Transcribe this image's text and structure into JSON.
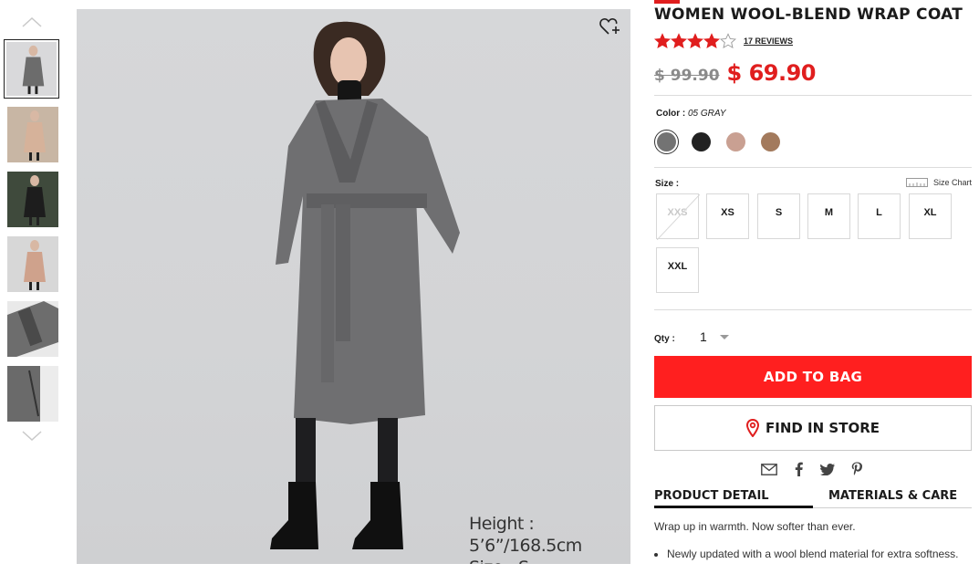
{
  "thumbnails": {
    "count": 6,
    "items": [
      {
        "name": "thumb-gray-front",
        "bg": "#d9d9db",
        "coat": "#6c6c6c"
      },
      {
        "name": "thumb-beige-indoor",
        "bg": "#c8b6a4",
        "coat": "#d6b29a"
      },
      {
        "name": "thumb-black-outdoor",
        "bg": "#3f4a3c",
        "coat": "#1d1d1d"
      },
      {
        "name": "thumb-beige-front",
        "bg": "#d7d7d7",
        "coat": "#cfa28c"
      },
      {
        "name": "thumb-belt-detail",
        "bg": "#e9e9e9",
        "coat": "#6d6d6d"
      },
      {
        "name": "thumb-hem-detail",
        "bg": "#ececec",
        "coat": "#6a6a6a"
      }
    ]
  },
  "main_image": {
    "caption_height": "Height : 5’6”/168.5cm",
    "caption_size": "Size : S"
  },
  "product": {
    "title": "WOMEN WOOL-BLEND WRAP COAT",
    "rating": 4,
    "rating_max": 5,
    "reviews_label": "17 REVIEWS",
    "old_price": "$ 99.90",
    "price": "$ 69.90"
  },
  "colors": {
    "label": "Color : ",
    "selected_name": "05 GRAY",
    "swatches": [
      {
        "hex": "#737373",
        "selected": true
      },
      {
        "hex": "#222222",
        "selected": false
      },
      {
        "hex": "#c9a092",
        "selected": false
      },
      {
        "hex": "#a37a5d",
        "selected": false
      }
    ]
  },
  "sizes": {
    "label": "Size :",
    "chart_label": "Size Chart",
    "options": [
      {
        "label": "XXS",
        "disabled": true
      },
      {
        "label": "XS",
        "disabled": false
      },
      {
        "label": "S",
        "disabled": false
      },
      {
        "label": "M",
        "disabled": false
      },
      {
        "label": "L",
        "disabled": false
      },
      {
        "label": "XL",
        "disabled": false
      },
      {
        "label": "XXL",
        "disabled": false
      }
    ]
  },
  "qty": {
    "label": "Qty :",
    "value": "1"
  },
  "actions": {
    "add_to_bag": "ADD TO BAG",
    "find_in_store": "FIND IN STORE"
  },
  "share": [
    "email-icon",
    "facebook-icon",
    "twitter-icon",
    "pinterest-icon"
  ],
  "tabs": {
    "product_detail": "PRODUCT DETAIL",
    "materials_care": "MATERIALS & CARE"
  },
  "detail": {
    "description": "Wrap up in warmth. Now softer than ever.",
    "bullets": [
      "Newly updated with a wool blend material for extra softness."
    ]
  },
  "colors_theme": {
    "accent": "#ff1f1f",
    "price_red": "#e01e1e"
  }
}
